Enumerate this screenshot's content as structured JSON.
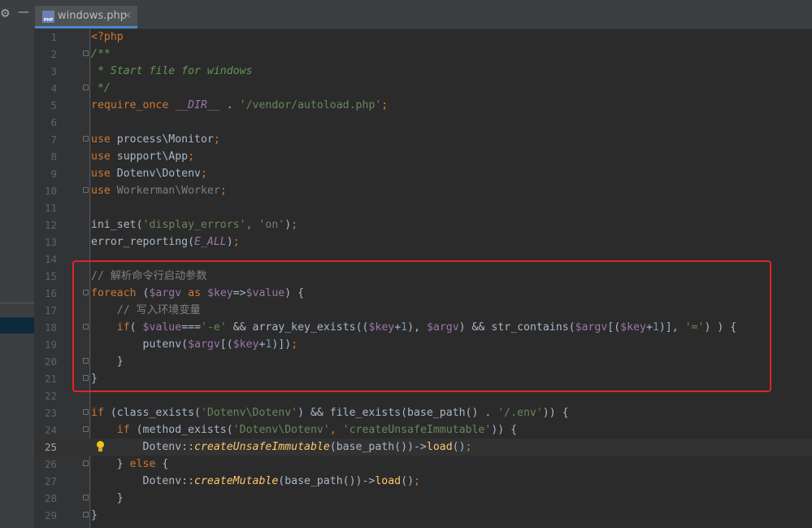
{
  "tab": {
    "filename": "windows.php",
    "close": "✕"
  },
  "current_line": 25,
  "lines": [
    {
      "n": 1,
      "fold": false,
      "tokens": [
        [
          "kw",
          "<?php"
        ]
      ]
    },
    {
      "n": 2,
      "fold": true,
      "tokens": [
        [
          "doc",
          "/**"
        ]
      ]
    },
    {
      "n": 3,
      "fold": false,
      "tokens": [
        [
          "doc",
          " * Start file for windows"
        ]
      ]
    },
    {
      "n": 4,
      "fold": true,
      "tokens": [
        [
          "doc",
          " */"
        ]
      ]
    },
    {
      "n": 5,
      "fold": false,
      "tokens": [
        [
          "kw",
          "require_once "
        ],
        [
          "cst",
          "__DIR__"
        ],
        [
          "tx",
          " . "
        ],
        [
          "str",
          "'/vendor/autoload.php'"
        ],
        [
          "pu",
          ";"
        ]
      ]
    },
    {
      "n": 6,
      "fold": false,
      "tokens": []
    },
    {
      "n": 7,
      "fold": true,
      "tokens": [
        [
          "kw",
          "use "
        ],
        [
          "tx",
          "process\\Monitor"
        ],
        [
          "pu",
          ";"
        ]
      ]
    },
    {
      "n": 8,
      "fold": false,
      "tokens": [
        [
          "kw",
          "use "
        ],
        [
          "tx",
          "support\\App"
        ],
        [
          "pu",
          ";"
        ]
      ]
    },
    {
      "n": 9,
      "fold": false,
      "tokens": [
        [
          "kw",
          "use "
        ],
        [
          "tx",
          "Dotenv\\Dotenv"
        ],
        [
          "pu",
          ";"
        ]
      ]
    },
    {
      "n": 10,
      "fold": true,
      "tokens": [
        [
          "kw",
          "use "
        ],
        [
          "dim",
          "Workerman\\Worker"
        ],
        [
          "pu",
          ";"
        ]
      ]
    },
    {
      "n": 11,
      "fold": false,
      "tokens": []
    },
    {
      "n": 12,
      "fold": false,
      "tokens": [
        [
          "tx",
          "ini_set("
        ],
        [
          "str",
          "'display_errors'"
        ],
        [
          "pu",
          ", "
        ],
        [
          "str",
          "'on'"
        ],
        [
          "tx",
          ")"
        ],
        [
          "pu",
          ";"
        ]
      ]
    },
    {
      "n": 13,
      "fold": false,
      "tokens": [
        [
          "tx",
          "error_reporting("
        ],
        [
          "cst",
          "E_ALL"
        ],
        [
          "tx",
          ")"
        ],
        [
          "pu",
          ";"
        ]
      ]
    },
    {
      "n": 14,
      "fold": false,
      "tokens": []
    },
    {
      "n": 15,
      "fold": false,
      "tokens": [
        [
          "cm",
          "// 解析命令行启动参数"
        ]
      ]
    },
    {
      "n": 16,
      "fold": true,
      "tokens": [
        [
          "kw",
          "foreach "
        ],
        [
          "tx",
          "("
        ],
        [
          "var",
          "$argv"
        ],
        [
          "kw",
          " as "
        ],
        [
          "var",
          "$key"
        ],
        [
          "tx",
          "=>"
        ],
        [
          "var",
          "$value"
        ],
        [
          "tx",
          ") {"
        ]
      ]
    },
    {
      "n": 17,
      "fold": false,
      "tokens": [
        [
          "tx",
          "    "
        ],
        [
          "cm",
          "// 写入环境变量"
        ]
      ]
    },
    {
      "n": 18,
      "fold": true,
      "tokens": [
        [
          "tx",
          "    "
        ],
        [
          "kw",
          "if"
        ],
        [
          "tx",
          "( "
        ],
        [
          "var",
          "$value"
        ],
        [
          "tx",
          "==="
        ],
        [
          "str",
          "'-e'"
        ],
        [
          "tx",
          " && array_key_exists(("
        ],
        [
          "var",
          "$key"
        ],
        [
          "tx",
          "+"
        ],
        [
          "num",
          "1"
        ],
        [
          "tx",
          "), "
        ],
        [
          "var",
          "$argv"
        ],
        [
          "tx",
          ") && str_contains("
        ],
        [
          "var",
          "$argv"
        ],
        [
          "tx",
          "[("
        ],
        [
          "var",
          "$key"
        ],
        [
          "tx",
          "+"
        ],
        [
          "num",
          "1"
        ],
        [
          "tx",
          ")], "
        ],
        [
          "str",
          "'='"
        ],
        [
          "tx",
          ") ) {"
        ]
      ]
    },
    {
      "n": 19,
      "fold": false,
      "tokens": [
        [
          "tx",
          "        putenv("
        ],
        [
          "var",
          "$argv"
        ],
        [
          "tx",
          "[("
        ],
        [
          "var",
          "$key"
        ],
        [
          "tx",
          "+"
        ],
        [
          "num",
          "1"
        ],
        [
          "tx",
          ")])"
        ],
        [
          "pu",
          ";"
        ]
      ]
    },
    {
      "n": 20,
      "fold": true,
      "tokens": [
        [
          "tx",
          "    }"
        ]
      ]
    },
    {
      "n": 21,
      "fold": true,
      "tokens": [
        [
          "tx",
          "}"
        ]
      ]
    },
    {
      "n": 22,
      "fold": false,
      "tokens": []
    },
    {
      "n": 23,
      "fold": true,
      "tokens": [
        [
          "kw",
          "if "
        ],
        [
          "tx",
          "(class_exists("
        ],
        [
          "str",
          "'Dotenv\\Dotenv'"
        ],
        [
          "tx",
          ") && file_exists(base_path() . "
        ],
        [
          "str",
          "'/.env'"
        ],
        [
          "tx",
          ")) {"
        ]
      ]
    },
    {
      "n": 24,
      "fold": true,
      "tokens": [
        [
          "tx",
          "    "
        ],
        [
          "kw",
          "if "
        ],
        [
          "tx",
          "(method_exists("
        ],
        [
          "str",
          "'Dotenv\\Dotenv'"
        ],
        [
          "pu",
          ", "
        ],
        [
          "str",
          "'createUnsafeImmutable'"
        ],
        [
          "tx",
          ")) {"
        ]
      ]
    },
    {
      "n": 25,
      "fold": false,
      "bulb": true,
      "tokens": [
        [
          "tx",
          "        Dotenv::"
        ],
        [
          "fnm",
          "createUnsafeImmutable"
        ],
        [
          "tx",
          "(base_path())->"
        ],
        [
          "fn",
          "load"
        ],
        [
          "tx",
          "()"
        ],
        [
          "pu",
          ";"
        ]
      ]
    },
    {
      "n": 26,
      "fold": true,
      "tokens": [
        [
          "tx",
          "    } "
        ],
        [
          "kw",
          "else "
        ],
        [
          "tx",
          "{"
        ]
      ]
    },
    {
      "n": 27,
      "fold": false,
      "tokens": [
        [
          "tx",
          "        Dotenv::"
        ],
        [
          "fnm",
          "createMutable"
        ],
        [
          "tx",
          "(base_path())->"
        ],
        [
          "fn",
          "load"
        ],
        [
          "tx",
          "()"
        ],
        [
          "pu",
          ";"
        ]
      ]
    },
    {
      "n": 28,
      "fold": true,
      "tokens": [
        [
          "tx",
          "    }"
        ]
      ]
    },
    {
      "n": 29,
      "fold": true,
      "tokens": [
        [
          "tx",
          "}"
        ]
      ]
    }
  ]
}
